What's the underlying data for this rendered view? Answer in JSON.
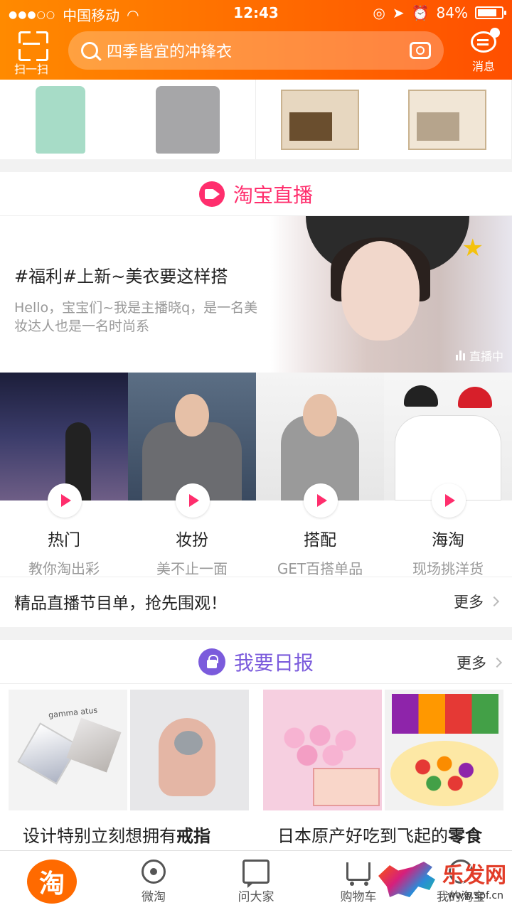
{
  "status_bar": {
    "carrier": "中国移动",
    "time": "12:43",
    "battery": "84%",
    "battery_level": 0.84
  },
  "header": {
    "scan_label": "扫一扫",
    "search_placeholder": "四季皆宜的冲锋衣",
    "message_label": "消息"
  },
  "live": {
    "title": "淘宝直播",
    "feature": {
      "title": "#福利#上新~美衣要这样搭",
      "desc": "Hello，宝宝们~我是主播晓q，是一名美妆达人也是一名时尚系",
      "badge": "直播中"
    },
    "categories": [
      {
        "name": "热门",
        "sub": "教你淘出彩"
      },
      {
        "name": "妆扮",
        "sub": "美不止一面"
      },
      {
        "name": "搭配",
        "sub": "GET百搭单品"
      },
      {
        "name": "海淘",
        "sub": "现场挑洋货"
      }
    ],
    "program_text": "精品直播节目单，抢先围观！",
    "more": "更多"
  },
  "daily": {
    "title": "我要日报",
    "more": "更多",
    "cards": [
      {
        "caption_prefix": "设计特别立刻想拥有",
        "caption_bold": "戒指",
        "ring_brand": "gamma atus"
      },
      {
        "caption_prefix": "日本原产好吃到飞起的",
        "caption_bold": "零食"
      }
    ]
  },
  "tabbar": {
    "home_glyph": "淘",
    "tabs": [
      "微淘",
      "问大家",
      "购物车",
      "我的淘宝"
    ]
  },
  "watermark": {
    "text": "乐发网",
    "url": "www.spf.cn"
  },
  "colors": {
    "brand_orange": "#ff6a00",
    "live_pink": "#ff2e6d",
    "daily_purple": "#7b5bdc"
  }
}
